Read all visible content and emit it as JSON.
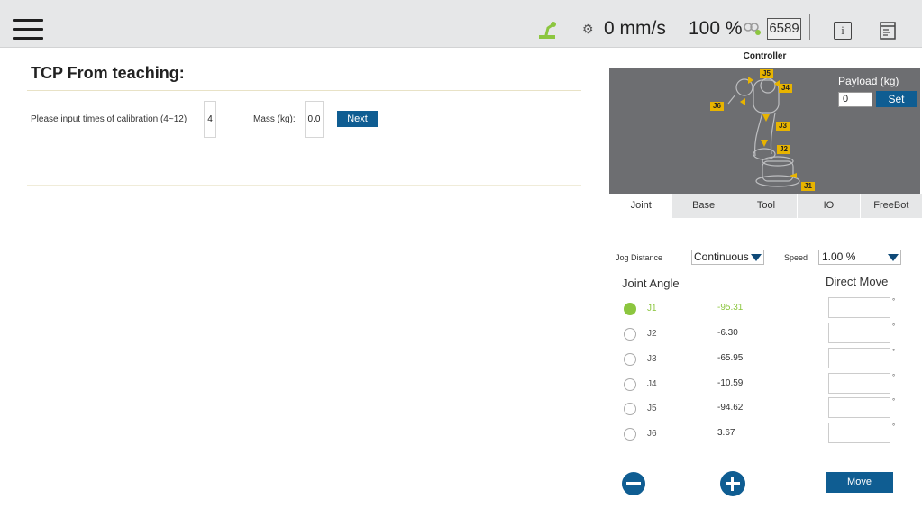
{
  "topbar": {
    "menu_icon": "hamburger-menu-icon",
    "robot_status_icon": "robot-arm-status-icon",
    "speed_icon": "speed-gauge-icon",
    "speed": "0 mm/s",
    "percent": "100 %",
    "link_icon": "connection-link-icon",
    "counter": "6589",
    "info_icon": "info-icon",
    "log_icon": "log-list-icon",
    "info_glyph": "i"
  },
  "main": {
    "title": "TCP From teaching:",
    "calibration_label": "Please input times of calibration (4~12)",
    "calibration_value": "4",
    "mass_label": "Mass (kg):",
    "mass_value": "0.0",
    "next_label": "Next"
  },
  "controller": {
    "label": "Controller",
    "payload_label": "Payload (kg)",
    "payload_value": "0",
    "set_label": "Set",
    "joint_tags": [
      "J5",
      "J4",
      "J6",
      "J3",
      "J2",
      "J1"
    ],
    "tabs": [
      {
        "label": "Joint",
        "active": true
      },
      {
        "label": "Base",
        "active": false
      },
      {
        "label": "Tool",
        "active": false
      },
      {
        "label": "IO",
        "active": false
      },
      {
        "label": "FreeBot",
        "active": false
      }
    ],
    "jog_distance_label": "Jog Distance",
    "jog_distance_value": "Continuous",
    "speed_label": "Speed",
    "speed_value": "1.00 %",
    "joint_angle_heading": "Joint Angle",
    "direct_move_heading": "Direct Move",
    "degree_sign": "°",
    "joints": [
      {
        "name": "J1",
        "value": "-95.31",
        "selected": true
      },
      {
        "name": "J2",
        "value": "-6.30",
        "selected": false
      },
      {
        "name": "J3",
        "value": "-65.95",
        "selected": false
      },
      {
        "name": "J4",
        "value": "-10.59",
        "selected": false
      },
      {
        "name": "J5",
        "value": "-94.62",
        "selected": false
      },
      {
        "name": "J6",
        "value": "3.67",
        "selected": false
      }
    ],
    "move_label": "Move"
  },
  "colors": {
    "accent_blue": "#0f5d92",
    "active_green": "#8cc63f",
    "joint_tag_yellow": "#e8b400",
    "viewport_gray": "#6d6e71"
  }
}
